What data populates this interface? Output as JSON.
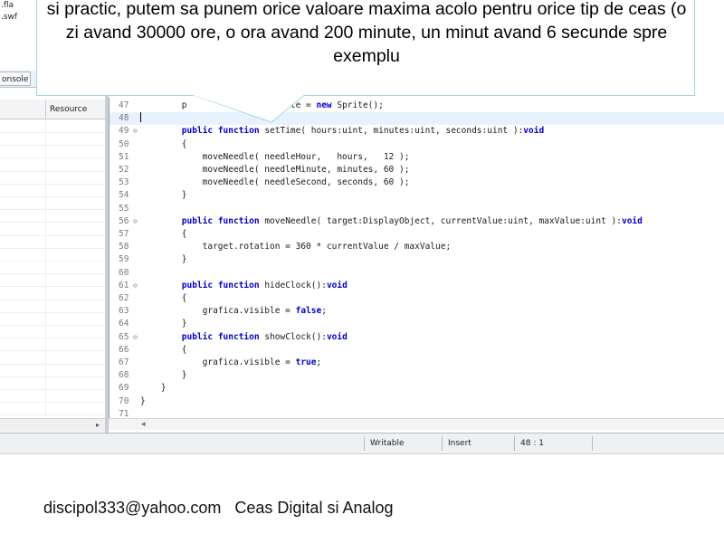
{
  "project_files": [
    ".fla",
    ".swf"
  ],
  "panel_tab": "onsole",
  "left_panel": {
    "column_resource": "Resource"
  },
  "editor": {
    "lines": [
      {
        "n": "47",
        "code": "        p              : Sprite = new Sprite();",
        "fold": ""
      },
      {
        "n": "48",
        "code": "",
        "fold": "",
        "current": true
      },
      {
        "n": "49",
        "code": "        public function setTime( hours:uint, minutes:uint, seconds:uint ):void",
        "fold": "⊖"
      },
      {
        "n": "50",
        "code": "        {",
        "fold": ""
      },
      {
        "n": "51",
        "code": "            moveNeedle( needleHour,   hours,   12 );",
        "fold": ""
      },
      {
        "n": "52",
        "code": "            moveNeedle( needleMinute, minutes, 60 );",
        "fold": ""
      },
      {
        "n": "53",
        "code": "            moveNeedle( needleSecond, seconds, 60 );",
        "fold": ""
      },
      {
        "n": "54",
        "code": "        }",
        "fold": ""
      },
      {
        "n": "55",
        "code": "",
        "fold": ""
      },
      {
        "n": "56",
        "code": "        public function moveNeedle( target:DisplayObject, currentValue:uint, maxValue:uint ):void",
        "fold": "⊖"
      },
      {
        "n": "57",
        "code": "        {",
        "fold": ""
      },
      {
        "n": "58",
        "code": "            target.rotation = 360 * currentValue / maxValue;",
        "fold": ""
      },
      {
        "n": "59",
        "code": "        }",
        "fold": ""
      },
      {
        "n": "60",
        "code": "",
        "fold": ""
      },
      {
        "n": "61",
        "code": "        public function hideClock():void",
        "fold": "⊖"
      },
      {
        "n": "62",
        "code": "        {",
        "fold": ""
      },
      {
        "n": "63",
        "code": "            grafica.visible = false;",
        "fold": ""
      },
      {
        "n": "64",
        "code": "        }",
        "fold": ""
      },
      {
        "n": "65",
        "code": "        public function showClock():void",
        "fold": "⊖"
      },
      {
        "n": "66",
        "code": "        {",
        "fold": ""
      },
      {
        "n": "67",
        "code": "            grafica.visible = true;",
        "fold": ""
      },
      {
        "n": "68",
        "code": "        }",
        "fold": ""
      },
      {
        "n": "69",
        "code": "    }",
        "fold": ""
      },
      {
        "n": "70",
        "code": "}",
        "fold": ""
      },
      {
        "n": "71",
        "code": "",
        "fold": ""
      }
    ]
  },
  "status_bar": {
    "mode": "Writable",
    "insert": "Insert",
    "position": "48 : 1"
  },
  "callout": {
    "text": "si practic, putem sa punem orice valoare maxima acolo pentru orice tip de ceas (o zi avand 30000 ore, o ora avand 200 minute, un minut avand 6 secunde spre exemplu"
  },
  "footer": {
    "email": "discipol333@yahoo.com",
    "title": "Ceas Digital si Analog"
  },
  "colors": {
    "keyword": "#0000cc",
    "current_line": "#e8f2fe",
    "callout_border": "#9fd6dc"
  }
}
